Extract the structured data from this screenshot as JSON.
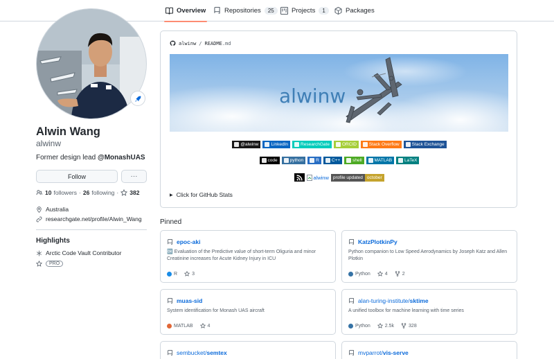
{
  "nav": {
    "tabs": [
      {
        "label": "Overview",
        "icon": "book-icon"
      },
      {
        "label": "Repositories",
        "count": "25",
        "icon": "repo-icon"
      },
      {
        "label": "Projects",
        "count": "1",
        "icon": "project-icon"
      },
      {
        "label": "Packages",
        "icon": "package-icon"
      }
    ]
  },
  "profile": {
    "name": "Alwin Wang",
    "login": "alwinw",
    "bio_prefix": "Former design lead ",
    "bio_org": "@MonashUAS",
    "follow_label": "Follow",
    "more_label": "···",
    "followers_count": "10",
    "followers_label": "followers",
    "following_count": "26",
    "following_label": "following",
    "stars_count": "382",
    "location": "Australia",
    "website": "researchgate.net/profile/Alwin_Wang",
    "highlights_title": "Highlights",
    "highlights": [
      {
        "label": "Arctic Code Vault Contributor"
      },
      {
        "label": "PRO"
      }
    ]
  },
  "readme": {
    "owner": "alwinw",
    "separator": "/",
    "file": "README",
    "ext": ".md",
    "banner_text": "alwinw",
    "badges_row1": [
      {
        "label": "@alwinw",
        "color": "#181717"
      },
      {
        "label": "LinkedIn",
        "color": "#0a66c2"
      },
      {
        "label": "ResearchGate",
        "color": "#00ccbb"
      },
      {
        "label": "ORCID",
        "color": "#a6ce39"
      },
      {
        "label": "Stack Overflow",
        "color": "#fe7a16"
      },
      {
        "label": "Stack Exchange",
        "color": "#1e5397"
      }
    ],
    "badges_row2": [
      {
        "label": "code",
        "color": "#000000"
      },
      {
        "label": "python",
        "color": "#3670a0"
      },
      {
        "label": "R",
        "color": "#276dc3"
      },
      {
        "label": "C++",
        "color": "#00599c"
      },
      {
        "label": "shell",
        "color": "#4eaa25"
      },
      {
        "label": "MATLAB",
        "color": "#0076a8"
      },
      {
        "label": "LaTeX",
        "color": "#008080"
      }
    ],
    "img_alt": "alwinw",
    "updated_label": "profile updated",
    "updated_value": "october",
    "details_label": "Click for GitHub Stats"
  },
  "pinned": {
    "title": "Pinned",
    "cards": [
      {
        "owner": "",
        "name": "epoc-aki",
        "desc": "🆗 Evaluation of the Predictive value of short-term Oliguria and minor Creatinine increases for Acute Kidney Injury in ICU",
        "lang": "R",
        "lang_color": "#198ce7",
        "stars": "3",
        "forks": ""
      },
      {
        "owner": "",
        "name": "KatzPlotkinPy",
        "desc": "Python companion to Low Speed Aerodynamics by Joseph Katz and Allen Plotkin",
        "lang": "Python",
        "lang_color": "#3572A5",
        "stars": "4",
        "forks": "2"
      },
      {
        "owner": "",
        "name": "muas-sid",
        "desc": "System identification for Monash UAS aircraft",
        "lang": "MATLAB",
        "lang_color": "#e16737",
        "stars": "4",
        "forks": ""
      },
      {
        "owner": "alan-turing-institute/",
        "name": "sktime",
        "desc": "A unified toolbox for machine learning with time series",
        "lang": "Python",
        "lang_color": "#3572A5",
        "stars": "2.5k",
        "forks": "328"
      },
      {
        "owner": "sembucket/",
        "name": "semtex",
        "desc": "",
        "lang": "",
        "lang_color": "",
        "stars": "",
        "forks": ""
      },
      {
        "owner": "mvparrot/",
        "name": "vis-serve",
        "desc": "",
        "lang": "",
        "lang_color": "",
        "stars": "",
        "forks": ""
      }
    ]
  },
  "colors": {
    "accent": "#0969da",
    "tab_underline": "#fd8c73",
    "border": "#d0d7de"
  }
}
